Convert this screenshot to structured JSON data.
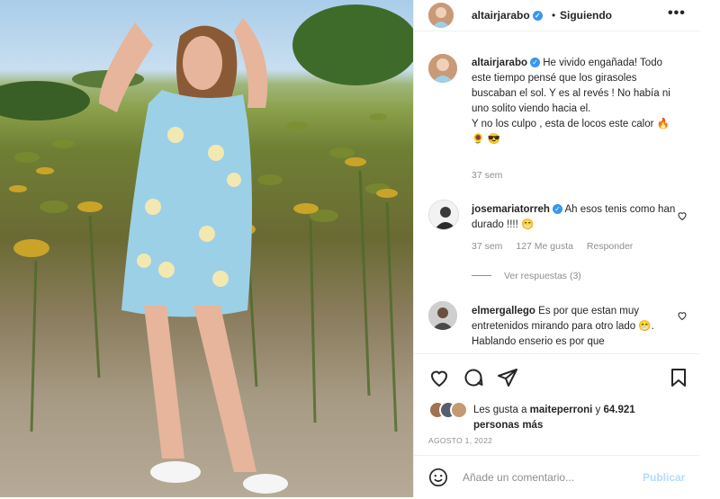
{
  "post": {
    "username": "altairjarabo",
    "follow_status": "Siguiendo",
    "separator": "•",
    "more_label": "•••"
  },
  "caption": {
    "username": "altairjarabo",
    "text": "He vivido engañada! Todo este tiempo pensé que los girasoles buscaban el sol. Y es al revés ! No había ni uno solito viendo hacia el.",
    "text2": "Y no los culpo , esta de locos este calor 🔥 🌻 😎",
    "time": "37 sem"
  },
  "comments": [
    {
      "username": "josemariatorreh",
      "text": "Ah esos tenis como han durado !!!! 😁",
      "time": "37 sem",
      "likes": "127 Me gusta",
      "reply": "Responder",
      "view_replies": "Ver respuestas (3)"
    },
    {
      "username": "elmergallego",
      "text": "Es por que estan muy entretenidos mirando para otro lado 😁. Hablando enserio es por que"
    }
  ],
  "likes": {
    "prefix": "Les gusta a",
    "user": "maiteperroni",
    "middle": "y",
    "count": "64.921",
    "suffix": "personas más"
  },
  "date": "AGOSTO 1, 2022",
  "add_comment": {
    "placeholder": "Añade un comentario...",
    "publish": "Publicar"
  },
  "icons": [
    "heart-icon",
    "comment-icon",
    "share-icon",
    "bookmark-icon",
    "emoji-icon",
    "more-icon",
    "verified-icon"
  ],
  "colors": {
    "verified": "#3897f0",
    "muted": "#8e8e8e",
    "publish": "#b3dbff"
  }
}
